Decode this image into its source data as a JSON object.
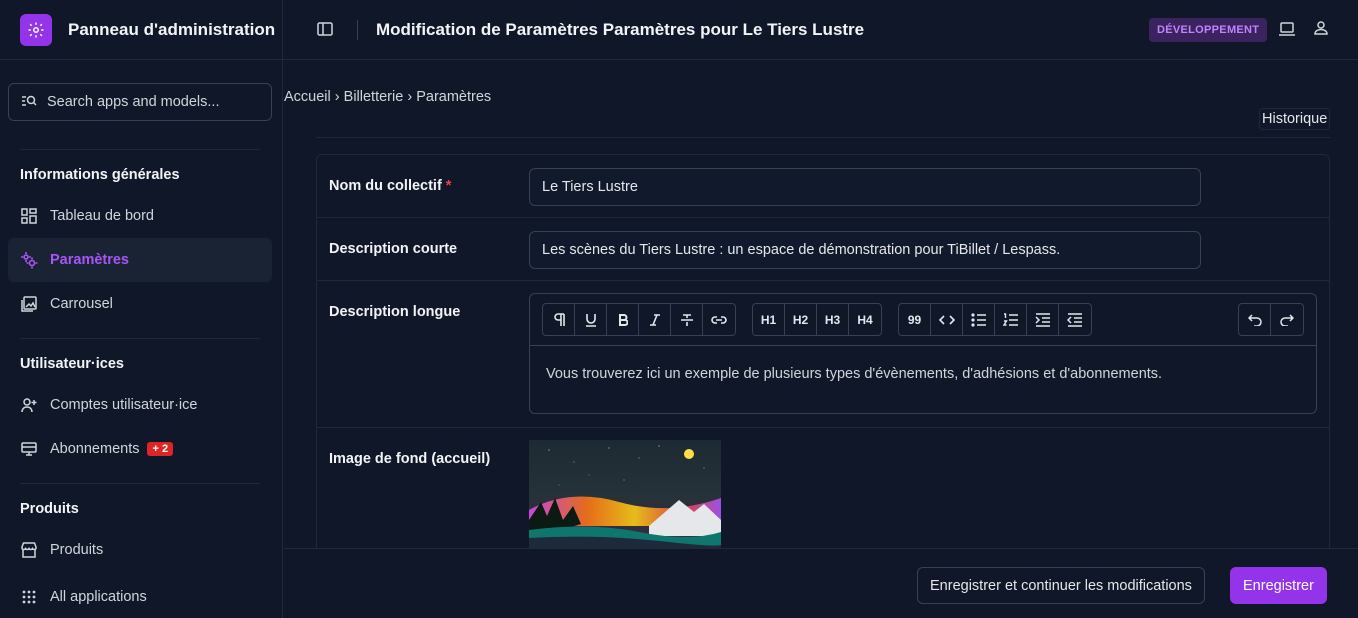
{
  "app": {
    "brand_title": "Panneau d'administration",
    "brand_icon": "gear-icon",
    "accent_color": "#9333ea"
  },
  "sidebar": {
    "search_placeholder": "Search apps and models...",
    "sections": [
      {
        "title": "Informations générales",
        "items": [
          {
            "label": "Tableau de bord",
            "icon": "dashboard-icon",
            "active": false
          },
          {
            "label": "Paramètres",
            "icon": "settings-icon",
            "active": true
          },
          {
            "label": "Carrousel",
            "icon": "image-gallery-icon",
            "active": false
          }
        ]
      },
      {
        "title": "Utilisateur·ices",
        "items": [
          {
            "label": "Comptes utilisateur·ice",
            "icon": "user-add-icon",
            "active": false
          },
          {
            "label": "Abonnements",
            "icon": "subscription-icon",
            "active": false,
            "badge": "+ 2"
          }
        ]
      },
      {
        "title": "Produits",
        "items": [
          {
            "label": "Produits",
            "icon": "store-icon",
            "active": false
          },
          {
            "label": "All applications",
            "icon": "grid-icon",
            "active": false
          }
        ]
      }
    ]
  },
  "header": {
    "page_title": "Modification de Paramètres Paramètres pour Le Tiers Lustre",
    "env_badge": "DÉVELOPPEMENT"
  },
  "breadcrumb": {
    "home": "Accueil",
    "app": "Billetterie",
    "current": "Paramètres",
    "separator": "›"
  },
  "history_label": "Historique",
  "form": {
    "nom": {
      "label": "Nom du collectif",
      "required_marker": "*",
      "value": "Le Tiers Lustre"
    },
    "desc_courte": {
      "label": "Description courte",
      "value": "Les scènes du Tiers Lustre : un espace de démonstration pour TiBillet / Lespass."
    },
    "desc_longue": {
      "label": "Description longue",
      "value": "Vous trouverez ici un exemple de plusieurs types d'évènements, d'adhésions et d'abonnements.",
      "toolbar": {
        "h1": "H1",
        "h2": "H2",
        "h3": "H3",
        "h4": "H4",
        "quote": "99"
      }
    },
    "image_fond": {
      "label": "Image de fond (accueil)"
    }
  },
  "footer": {
    "save_continue_label": "Enregistrer et continuer les modifications",
    "save_label": "Enregistrer"
  }
}
